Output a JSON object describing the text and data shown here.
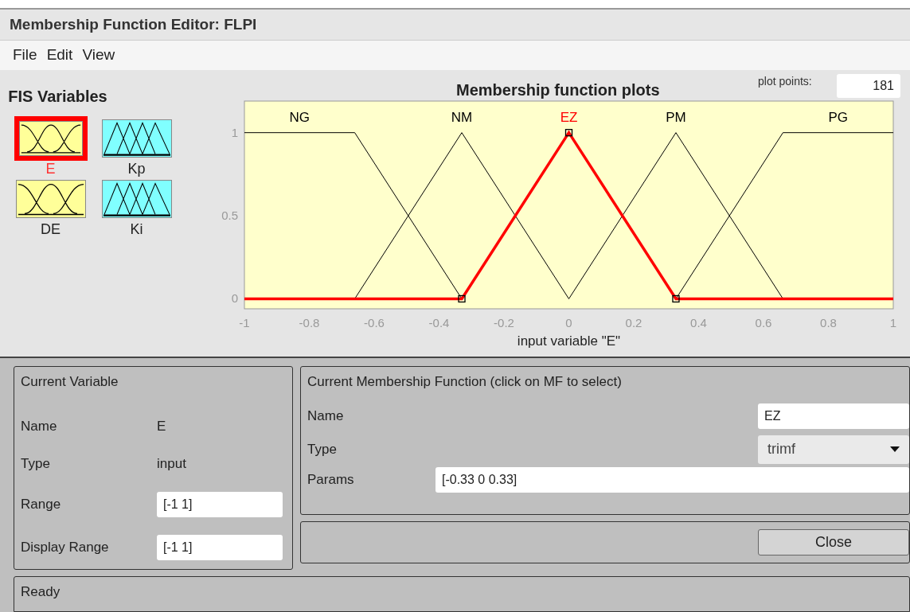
{
  "window": {
    "title": "Membership Function Editor: FLPI"
  },
  "menu": [
    "File",
    "Edit",
    "View"
  ],
  "fis_variables": {
    "title": "FIS Variables",
    "items": [
      {
        "name": "E",
        "kind": "input",
        "selected": true
      },
      {
        "name": "Kp",
        "kind": "output",
        "selected": false
      },
      {
        "name": "DE",
        "kind": "input",
        "selected": false
      },
      {
        "name": "Ki",
        "kind": "output",
        "selected": false
      }
    ]
  },
  "plot": {
    "plot_points_label": "plot points:",
    "plot_points": "181",
    "chart_data": {
      "type": "line",
      "title": "Membership function plots",
      "xlabel": "input variable \"E\"",
      "x": [
        -1,
        -0.66,
        -0.33,
        0,
        0.33,
        0.66,
        1
      ],
      "xlim": [
        -1,
        1
      ],
      "ylim": [
        -0.06,
        1.19
      ],
      "xticks": [
        -1,
        -0.8,
        -0.6,
        -0.4,
        -0.2,
        0,
        0.2,
        0.4,
        0.6,
        0.8,
        1
      ],
      "yticks": [
        0,
        0.5,
        1
      ],
      "series": [
        {
          "name": "NG",
          "color": "#000000",
          "values": [
            1,
            1,
            0,
            null,
            null,
            null,
            null
          ]
        },
        {
          "name": "NM",
          "color": "#000000",
          "values": [
            null,
            0,
            1,
            0,
            null,
            null,
            null
          ]
        },
        {
          "name": "EZ",
          "color": "#ff0000",
          "values": [
            0,
            0,
            0,
            1,
            0,
            0,
            0
          ]
        },
        {
          "name": "PM",
          "color": "#000000",
          "values": [
            null,
            null,
            null,
            0,
            1,
            0,
            null
          ]
        },
        {
          "name": "PG",
          "color": "#000000",
          "values": [
            null,
            null,
            null,
            null,
            0,
            1,
            1
          ]
        }
      ]
    },
    "membership_functions": [
      {
        "selected": false
      },
      {
        "selected": false
      },
      {
        "selected": true
      },
      {
        "selected": false
      },
      {
        "selected": false
      }
    ]
  },
  "current_variable": {
    "title": "Current Variable",
    "name_label": "Name",
    "name": "E",
    "type_label": "Type",
    "type": "input",
    "range_label": "Range",
    "range": "[-1 1]",
    "display_range_label": "Display Range",
    "display_range": "[-1 1]"
  },
  "current_mf": {
    "title": "Current Membership Function (click on MF to select)",
    "name_label": "Name",
    "name": "EZ",
    "type_label": "Type",
    "type": "trimf",
    "params_label": "Params",
    "params": "[-0.33 0 0.33]"
  },
  "close_button": "Close",
  "status": "Ready"
}
